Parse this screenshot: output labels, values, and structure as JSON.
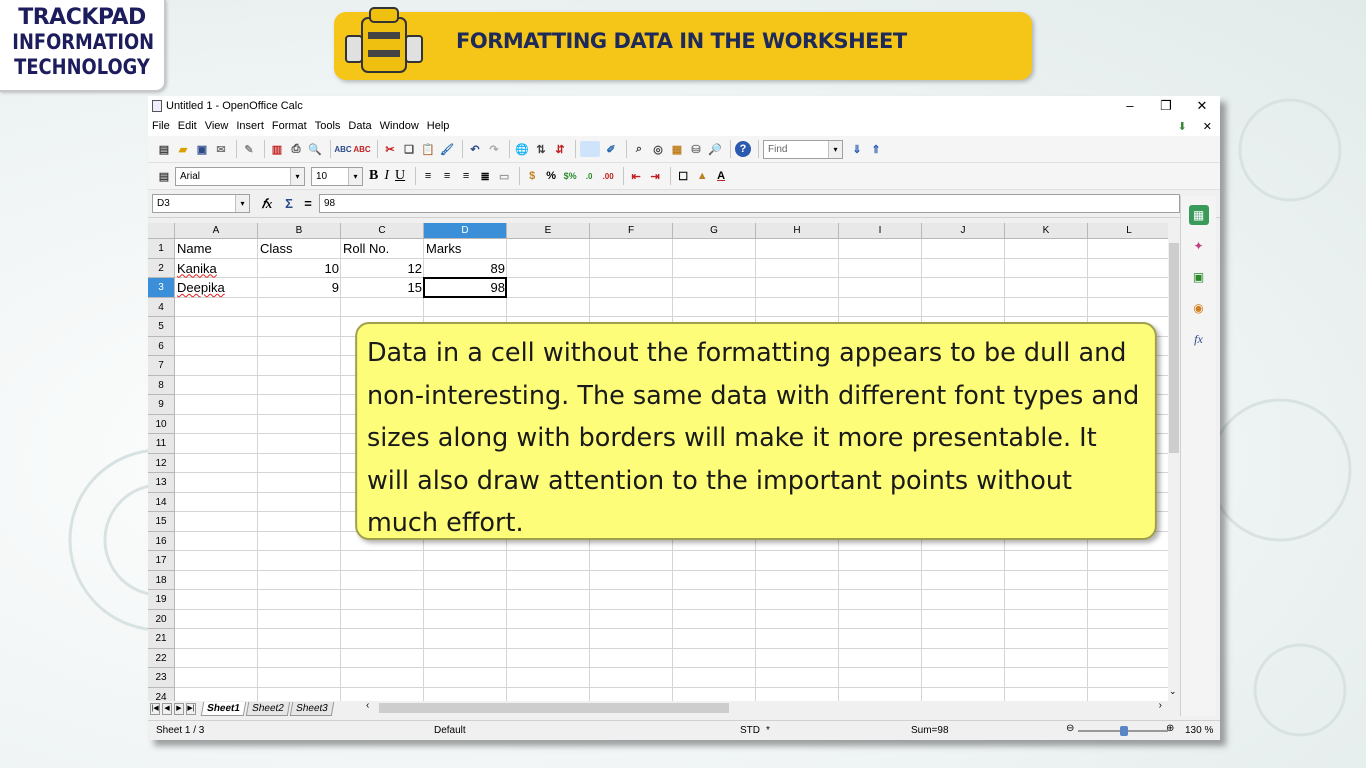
{
  "logo": {
    "line1": "TRACKPAD",
    "line2": "INFORMATION",
    "line3": "TECHNOLOGY"
  },
  "banner": {
    "title": "FORMATTING DATA IN THE WORKSHEET"
  },
  "window": {
    "title": "Untitled 1 - OpenOffice Calc",
    "menu": [
      "File",
      "Edit",
      "View",
      "Insert",
      "Format",
      "Tools",
      "Data",
      "Window",
      "Help"
    ]
  },
  "toolbar": {
    "find_placeholder": "Find",
    "font_name": "Arial",
    "font_size": "10",
    "bold_label": "B",
    "italic_label": "I",
    "underline_label": "U"
  },
  "formula_bar": {
    "name_box": "D3",
    "fx": "𝑓x",
    "sum": "Σ",
    "equals": "=",
    "content": "98"
  },
  "sheet": {
    "columns": [
      "A",
      "B",
      "C",
      "D",
      "E",
      "F",
      "G",
      "H",
      "I",
      "J",
      "K",
      "L"
    ],
    "rows": [
      "1",
      "2",
      "3",
      "4",
      "5",
      "6",
      "7",
      "8",
      "9",
      "10",
      "11",
      "12",
      "13",
      "14",
      "15",
      "16",
      "17",
      "18",
      "19",
      "20",
      "21",
      "22",
      "23",
      "24"
    ],
    "header_row": [
      "Name",
      "Class",
      "Roll No.",
      "Marks"
    ],
    "data": [
      [
        "Kanika",
        "10",
        "12",
        "89"
      ],
      [
        "Deepika",
        "9",
        "15",
        "98"
      ]
    ],
    "selected_cell": "D3",
    "tabs": [
      "Sheet1",
      "Sheet2",
      "Sheet3"
    ],
    "active_tab": "Sheet1"
  },
  "status": {
    "sheet": "Sheet 1 / 3",
    "style": "Default",
    "mode": "STD",
    "modified": "*",
    "sum": "Sum=98",
    "zoom": "130 %"
  },
  "callout": {
    "text": "Data in a cell without the formatting appears to be dull and non-interesting. The same data with different font types and sizes along with borders will make it more presentable. It will also draw attention to the important points without much effort."
  },
  "colors": {
    "banner": "#f5c518",
    "callout": "#fdfd7a",
    "selection": "#3a8fd8",
    "logo_text": "#1d1d5e"
  }
}
